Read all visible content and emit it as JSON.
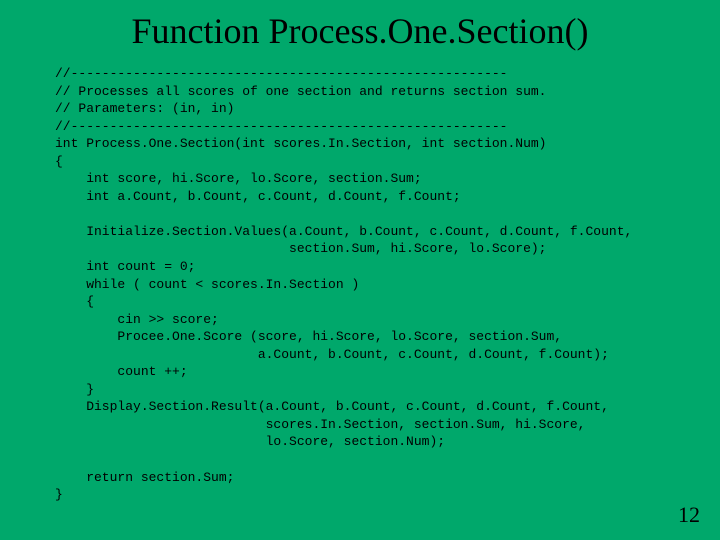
{
  "title": "Function Process.One.Section()",
  "code": "//--------------------------------------------------------\n// Processes all scores of one section and returns section sum.\n// Parameters: (in, in)\n//--------------------------------------------------------\nint Process.One.Section(int scores.In.Section, int section.Num)\n{\n    int score, hi.Score, lo.Score, section.Sum;\n    int a.Count, b.Count, c.Count, d.Count, f.Count;\n\n    Initialize.Section.Values(a.Count, b.Count, c.Count, d.Count, f.Count,\n                              section.Sum, hi.Score, lo.Score);\n    int count = 0;\n    while ( count < scores.In.Section )\n    {\n        cin >> score;\n        Procee.One.Score (score, hi.Score, lo.Score, section.Sum,\n                          a.Count, b.Count, c.Count, d.Count, f.Count);\n        count ++;\n    }\n    Display.Section.Result(a.Count, b.Count, c.Count, d.Count, f.Count,\n                           scores.In.Section, section.Sum, hi.Score,\n                           lo.Score, section.Num);\n\n    return section.Sum;\n}",
  "page_number": "12"
}
